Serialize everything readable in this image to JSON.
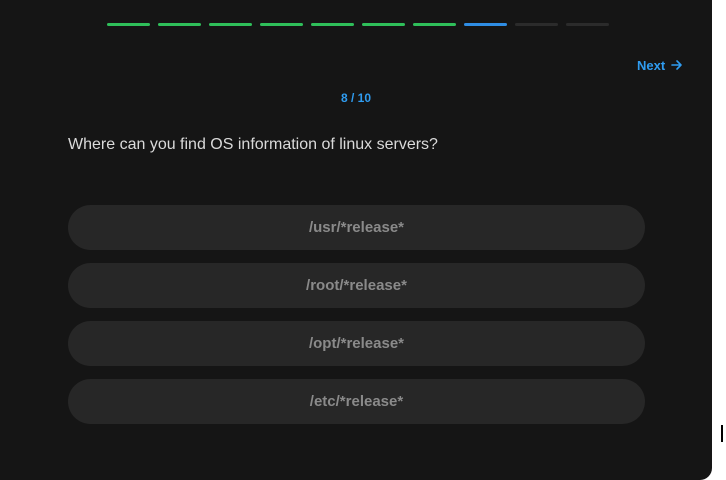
{
  "progress": {
    "total": 10,
    "current": 8,
    "completed": 7,
    "colors": {
      "done": "#2fbf5a",
      "current": "#2f8de4",
      "pending": "#2b2b2b"
    }
  },
  "nav": {
    "next_label": "Next",
    "next_icon": "arrow-right-icon"
  },
  "counter_text": "8 / 10",
  "question": "Where can you find OS information of linux servers?",
  "options": [
    {
      "label": "/usr/*release*"
    },
    {
      "label": "/root/*release*"
    },
    {
      "label": "/opt/*release*"
    },
    {
      "label": "/etc/*release*"
    }
  ],
  "accent_color": "#2f9cf0"
}
